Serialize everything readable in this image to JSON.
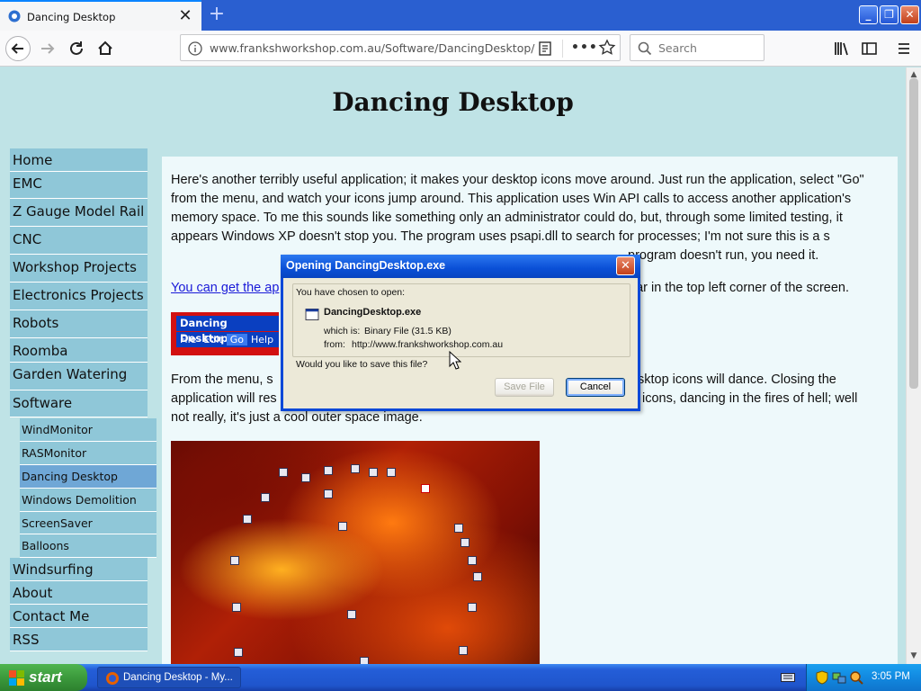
{
  "browser": {
    "tab_title": "Dancing Desktop",
    "new_tab_symbol": "+",
    "tab_close_symbol": "✕",
    "url_host": "www.frankshworkshop.com.au",
    "url_path": "/Software/DancingDesktop/",
    "search_placeholder": "Search",
    "more_symbol": "•••",
    "window_buttons": {
      "minimize": "_",
      "restore": "❐",
      "close": "✕"
    }
  },
  "page": {
    "title": "Dancing Desktop",
    "paragraph1": "Here's another terribly useful application; it makes your desktop icons move around. Just run the application, select \"Go\" from the menu, and watch your icons jump around.  This application uses Win API calls to access another application's memory space.  To me this sounds like something only an administrator could do, but, through some limited testing, it appears Windows XP doesn't stop you.  The program uses psapi.dll to search for processes; I'm not sure this is a s",
    "paragraph1_tail": "program doesn't run, you need it.",
    "link_text": "You can get the ap",
    "paragraph2_tail": "ear in the top left corner of the screen.",
    "paragraph3_start": "From the menu, s",
    "paragraph3_line1_tail": "sktop icons will dance.  Closing the",
    "paragraph3_line2_start": "application will res",
    "paragraph3_line2_tail": "icons, dancing in the fires of hell; well",
    "paragraph3_line3": "not really, it's just a cool outer space image.",
    "menu_sample": {
      "title": "Dancing Desktop",
      "items": [
        "File",
        "Edit",
        "Go",
        "Help"
      ]
    }
  },
  "sidebar": {
    "items": [
      "Home",
      "EMC",
      "Z Gauge Model Rail",
      "CNC",
      "Workshop Projects",
      "Electronics Projects",
      "Robots",
      "Roomba",
      "Garden Watering",
      "Software"
    ],
    "sub_items": [
      "WindMonitor",
      "RASMonitor",
      "Dancing Desktop",
      "Windows Demolition",
      "ScreenSaver",
      "Balloons"
    ],
    "items_after": [
      "Windsurfing",
      "About",
      "Contact Me",
      "RSS"
    ]
  },
  "dialog": {
    "title": "Opening DancingDesktop.exe",
    "close_symbol": "✕",
    "chosen_label": "You have chosen to open:",
    "file_name": "DancingDesktop.exe",
    "which_is_label": "which is:",
    "which_is_value": "Binary File (31.5 KB)",
    "from_label": "from:",
    "from_value": "http://www.frankshworkshop.com.au",
    "question": "Would you like to save this file?",
    "save_label": "Save File",
    "cancel_label": "Cancel"
  },
  "taskbar": {
    "start_label": "start",
    "task_label": "Dancing Desktop - My...",
    "time": "3:05 PM"
  }
}
